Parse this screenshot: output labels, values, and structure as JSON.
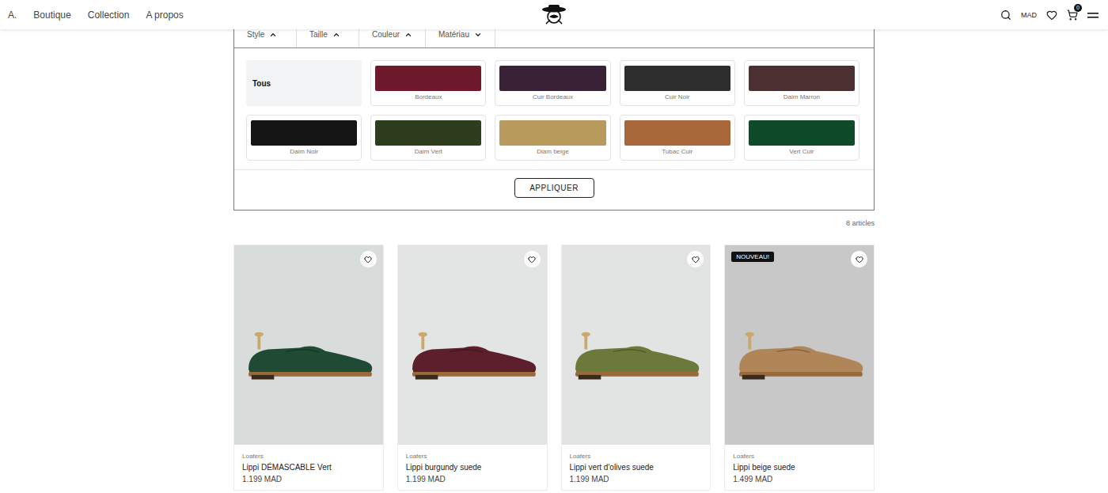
{
  "header": {
    "brand": "A.",
    "links": [
      "Boutique",
      "Collection",
      "A propos"
    ],
    "currency": "MAD",
    "cart_count": "0"
  },
  "filters": {
    "tabs": [
      {
        "label": "Style",
        "expanded": true
      },
      {
        "label": "Taille",
        "expanded": true
      },
      {
        "label": "Couleur",
        "expanded": true
      },
      {
        "label": "Matériau",
        "expanded": false
      }
    ],
    "all_option": {
      "label": "Tous",
      "selected": true
    },
    "swatches": [
      {
        "label": "Bordeaux",
        "color": "#6e1a2c",
        "selected": false
      },
      {
        "label": "Cuir Bordeaux",
        "color": "#3a2236",
        "selected": false
      },
      {
        "label": "Cuir Noir",
        "color": "#2d2d2d",
        "selected": false
      },
      {
        "label": "Daim Marron",
        "color": "#4a3030",
        "selected": false
      },
      {
        "label": "Daim Noir",
        "color": "#151515",
        "selected": false
      },
      {
        "label": "Daim Vert",
        "color": "#2f3d1f",
        "selected": false
      },
      {
        "label": "Diam beige",
        "color": "#b89a5c",
        "selected": false
      },
      {
        "label": "Tubac Cuir",
        "color": "#a8683a",
        "selected": false
      },
      {
        "label": "Vert Cuir",
        "color": "#0f4a2a",
        "selected": false
      }
    ],
    "apply_button": "APPLIQUER"
  },
  "results": {
    "count": "8 articles"
  },
  "products": [
    {
      "category": "Loafers",
      "name": "Lippi DÉMASCABLE Vert",
      "price": "1.199 MAD",
      "badge": "",
      "favorite": false,
      "color": "#1f4a33"
    },
    {
      "category": "Loafers",
      "name": "Lippi burgundy suede",
      "price": "1.199 MAD",
      "badge": "",
      "favorite": false,
      "color": "#5c1f2b"
    },
    {
      "category": "Loafers",
      "name": "Lippi vert d'olives suede",
      "price": "1.199 MAD",
      "badge": "",
      "favorite": false,
      "color": "#6b7a3a"
    },
    {
      "category": "Loafers",
      "name": "Lippi beige suede",
      "price": "1.499 MAD",
      "badge": "NOUVEAU!",
      "favorite": false,
      "color": "#b08658"
    }
  ]
}
